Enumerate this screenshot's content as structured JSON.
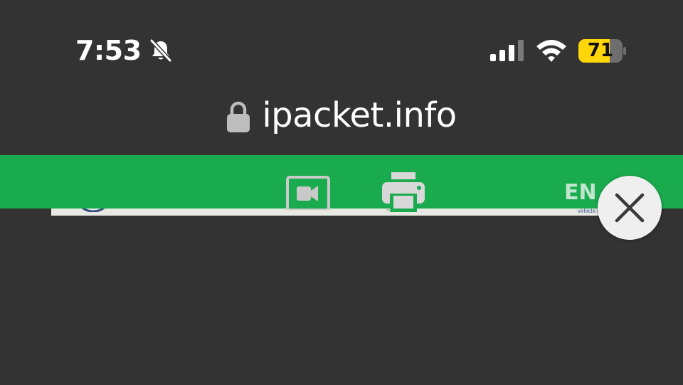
{
  "status_bar": {
    "time": "7:53",
    "silent_icon": "bell-slash-icon",
    "signal_icon": "cellular-signal-icon",
    "wifi_icon": "wifi-icon",
    "battery_percent": "71",
    "battery_color": "#ffd60a"
  },
  "address_bar": {
    "lock_icon": "lock-icon",
    "url": "ipacket.info"
  },
  "toolbar": {
    "background_color": "#19ab4d",
    "video_icon": "video-camera-icon",
    "print_icon": "printer-icon",
    "language": "EN",
    "language_caption": "vehicle h"
  },
  "overlay": {
    "close_icon": "close-icon"
  }
}
